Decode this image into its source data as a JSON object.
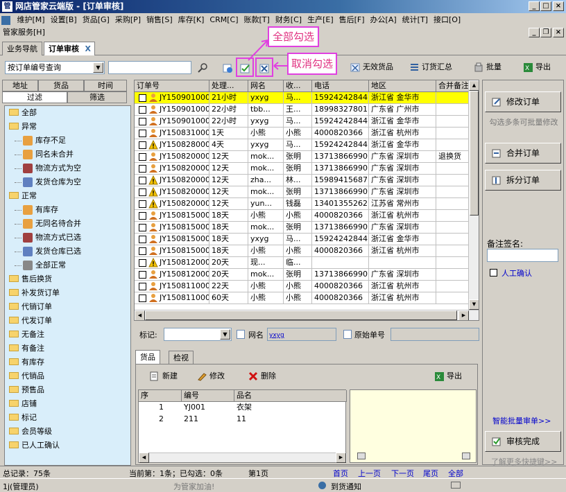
{
  "window": {
    "title": "网店管家云端版 - [订单审核]",
    "app_icon": "管"
  },
  "menu": [
    "维护[M]",
    "设置[B]",
    "货品[G]",
    "采购[P]",
    "销售[S]",
    "库存[K]",
    "CRM[C]",
    "账款[T]",
    "财务[C]",
    "生产[E]",
    "售后[F]",
    "办公[A]",
    "统计[T]",
    "接口[O]"
  ],
  "menu2": "管家服务[H]",
  "tabs": {
    "nav": "业务导航",
    "active": "订单审核",
    "close": "X"
  },
  "toolbar": {
    "query_select": "按订单编号查询",
    "search_value": "",
    "invalid_goods": "无效货品",
    "order_summary": "订货汇总",
    "batch": "批量",
    "export": "导出"
  },
  "callouts": {
    "select_all": "全部勾选",
    "unselect_all": "取消勾选"
  },
  "left": {
    "tab_address": "地址",
    "tab_goods": "货品",
    "tab_time": "时间",
    "tab_filter": "过滤",
    "tab_screen": "筛选"
  },
  "tree": [
    {
      "label": "全部",
      "level": 0,
      "icon": "folder"
    },
    {
      "label": "异常",
      "level": 0,
      "icon": "folder"
    },
    {
      "label": "库存不足",
      "level": 1,
      "icon": "person"
    },
    {
      "label": "同名未合并",
      "level": 1,
      "icon": "person"
    },
    {
      "label": "物流方式为空",
      "level": 1,
      "icon": "truck"
    },
    {
      "label": "发货仓库为空",
      "level": 1,
      "icon": "warehouse"
    },
    {
      "label": "正常",
      "level": 0,
      "icon": "folder"
    },
    {
      "label": "有库存",
      "level": 1,
      "icon": "person"
    },
    {
      "label": "无同名待合并",
      "level": 1,
      "icon": "person"
    },
    {
      "label": "物流方式已选",
      "level": 1,
      "icon": "truck"
    },
    {
      "label": "发货仓库已选",
      "level": 1,
      "icon": "warehouse"
    },
    {
      "label": "全部正常",
      "level": 1,
      "icon": "hand"
    },
    {
      "label": "售后换货",
      "level": 0,
      "icon": "folder"
    },
    {
      "label": "补发货订单",
      "level": 0,
      "icon": "folder"
    },
    {
      "label": "代销订单",
      "level": 0,
      "icon": "folder"
    },
    {
      "label": "代发订单",
      "level": 0,
      "icon": "folder"
    },
    {
      "label": "无备注",
      "level": 0,
      "icon": "folder"
    },
    {
      "label": "有备注",
      "level": 0,
      "icon": "folder"
    },
    {
      "label": "有库存",
      "level": 0,
      "icon": "folder"
    },
    {
      "label": "代销品",
      "level": 0,
      "icon": "folder"
    },
    {
      "label": "预售品",
      "level": 0,
      "icon": "folder"
    },
    {
      "label": "店铺",
      "level": 0,
      "icon": "folder"
    },
    {
      "label": "标记",
      "level": 0,
      "icon": "folder"
    },
    {
      "label": "会员等级",
      "level": 0,
      "icon": "folder"
    },
    {
      "label": "已人工确认",
      "level": 0,
      "icon": "folder"
    }
  ],
  "grid": {
    "headers": [
      "订单号",
      "处理...",
      "网名",
      "收...",
      "电话",
      "地区",
      "合并备注"
    ],
    "rows": [
      {
        "icon": "person",
        "id": "JY1509010003",
        "time": "21小时",
        "nick": "yxyg",
        "recv": "马...",
        "phone": "15924242844",
        "region": "浙江省 金华市",
        "note": ""
      },
      {
        "icon": "person",
        "id": "JY1509010002",
        "time": "22小时",
        "nick": "tbb...",
        "recv": "王...",
        "phone": "18998327801",
        "region": "广东省 广州市",
        "note": ""
      },
      {
        "icon": "person",
        "id": "JY1509010001",
        "time": "22小时",
        "nick": "yxyg",
        "recv": "马...",
        "phone": "15924242844",
        "region": "浙江省 金华市",
        "note": ""
      },
      {
        "icon": "person",
        "id": "JY1508310001",
        "time": "1天",
        "nick": "小熊",
        "recv": "小熊",
        "phone": "4000820366",
        "region": "浙江省 杭州市",
        "note": ""
      },
      {
        "icon": "warn",
        "id": "JY1508280003",
        "time": "4天",
        "nick": "yxyg",
        "recv": "马...",
        "phone": "15924242844",
        "region": "浙江省 金华市",
        "note": ""
      },
      {
        "icon": "person",
        "id": "JY1508200006",
        "time": "12天",
        "nick": "mok...",
        "recv": "张明",
        "phone": "13713866990",
        "region": "广东省 深圳市",
        "note": "退换货"
      },
      {
        "icon": "person",
        "id": "JY1508200005",
        "time": "12天",
        "nick": "mok...",
        "recv": "张明",
        "phone": "13713866990",
        "region": "广东省 深圳市",
        "note": ""
      },
      {
        "icon": "warn",
        "id": "JY1508200004",
        "time": "12天",
        "nick": "zha...",
        "recv": "林...",
        "phone": "15989415687",
        "region": "广东省 深圳市",
        "note": ""
      },
      {
        "icon": "warn",
        "id": "JY1508200003",
        "time": "12天",
        "nick": "mok...",
        "recv": "张明",
        "phone": "13713866990",
        "region": "广东省 深圳市",
        "note": ""
      },
      {
        "icon": "warn",
        "id": "JY1508200001",
        "time": "12天",
        "nick": "yun...",
        "recv": "钱磊",
        "phone": "13401355262",
        "region": "江苏省 常州市",
        "note": ""
      },
      {
        "icon": "person",
        "id": "JY1508150004",
        "time": "18天",
        "nick": "小熊",
        "recv": "小熊",
        "phone": "4000820366",
        "region": "浙江省 杭州市",
        "note": ""
      },
      {
        "icon": "person",
        "id": "JY1508150003",
        "time": "18天",
        "nick": "mok...",
        "recv": "张明",
        "phone": "13713866990",
        "region": "广东省 深圳市",
        "note": ""
      },
      {
        "icon": "person",
        "id": "JY1508150002",
        "time": "18天",
        "nick": "yxyg",
        "recv": "马...",
        "phone": "15924242844",
        "region": "浙江省 金华市",
        "note": ""
      },
      {
        "icon": "person",
        "id": "JY1508150001",
        "time": "18天",
        "nick": "小熊",
        "recv": "小熊",
        "phone": "4000820366",
        "region": "浙江省 杭州市",
        "note": ""
      },
      {
        "icon": "warn",
        "id": "JY1508120006",
        "time": "20天",
        "nick": "现...",
        "recv": "临...",
        "phone": "",
        "region": "",
        "note": ""
      },
      {
        "icon": "person",
        "id": "JY1508120005",
        "time": "20天",
        "nick": "mok...",
        "recv": "张明",
        "phone": "13713866990",
        "region": "广东省 深圳市",
        "note": ""
      },
      {
        "icon": "person",
        "id": "JY1508110003",
        "time": "22天",
        "nick": "小熊",
        "recv": "小熊",
        "phone": "4000820366",
        "region": "浙江省 杭州市",
        "note": ""
      },
      {
        "icon": "person",
        "id": "JY1508110001",
        "time": "60天",
        "nick": "小熊",
        "recv": "小熊",
        "phone": "4000820366",
        "region": "浙江省 杭州市",
        "note": ""
      }
    ]
  },
  "mark_bar": {
    "mark_label": "标记:",
    "mark_value": "",
    "nick_label": "网名",
    "nick_value": "yxyg",
    "orig_label": "原始单号",
    "orig_value": ""
  },
  "bottom": {
    "tab_goods": "货品",
    "tab_check": "检视",
    "new": "新建",
    "edit": "修改",
    "delete": "删除",
    "export": "导出",
    "headers": [
      "序",
      "编号",
      "品名"
    ],
    "rows": [
      {
        "seq": "1",
        "code": "YJ001",
        "name": "衣架"
      },
      {
        "seq": "2",
        "code": "211",
        "name": "11"
      }
    ]
  },
  "right": {
    "modify_order": "修改订单",
    "batch_hint": "勾选多条可批量修改",
    "merge_order": "合并订单",
    "split_order": "拆分订单",
    "remark_label": "备注签名:",
    "remark_value": "",
    "manual_confirm": "人工确认",
    "smart_batch": "智能批量审单>>",
    "audit_done": "审核完成",
    "learn_more": "了解更多快捷键>>"
  },
  "status": {
    "total": "总记录：75条",
    "current": "当前第：1条；已勾选：0条",
    "page": "第1页",
    "first": "首页",
    "prev": "上一页",
    "next": "下一页",
    "last": "尾页",
    "all": "全部"
  },
  "status2": {
    "user": "1j(管理员)",
    "slogan": "为管家加油!",
    "notice": "到货通知"
  }
}
